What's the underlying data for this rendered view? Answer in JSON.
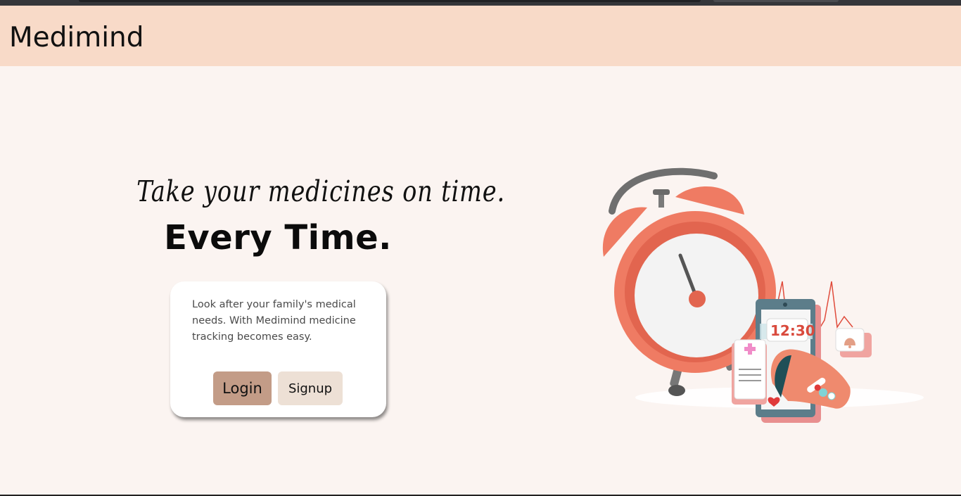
{
  "header": {
    "brand": "Medimind"
  },
  "hero": {
    "tagline": "Take your medicines on time.",
    "headline": "Every Time."
  },
  "card": {
    "description": "Look after your family's medical needs. With Medimind medicine tracking becomes easy.",
    "login_label": "Login",
    "signup_label": "Signup"
  },
  "illustration": {
    "phone_time": "12:30",
    "icons": [
      "alarm-clock-icon",
      "phone-icon",
      "medical-card-icon",
      "hand-pills-icon",
      "bell-icon",
      "heart-icon"
    ]
  },
  "colors": {
    "header_bg": "#f8dac8",
    "page_bg": "#fbf4f1",
    "login_bg": "#c39c87",
    "signup_bg": "#ede0d5",
    "clock": "#ef7b63"
  }
}
